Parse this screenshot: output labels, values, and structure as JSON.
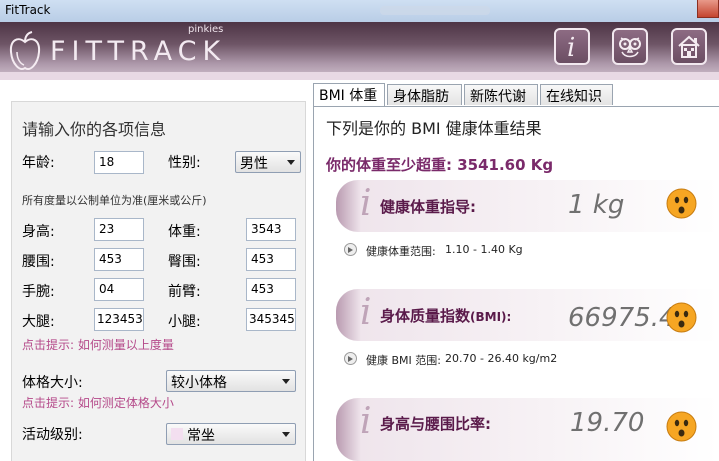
{
  "window": {
    "title": "FitTrack"
  },
  "header": {
    "logo_text": "FITTRACK",
    "logo_sub": "pinkies",
    "buttons": [
      {
        "name": "info-icon"
      },
      {
        "name": "owl-icon"
      },
      {
        "name": "home-icon"
      }
    ]
  },
  "form": {
    "title": "请输入你的各项信息",
    "age_label": "年龄:",
    "age_value": "18",
    "gender_label": "性别:",
    "gender_value": "男性",
    "units_note": "所有度量以公制单位为准(厘米或公斤)",
    "height_label": "身高:",
    "height_value": "23",
    "weight_label": "体重:",
    "weight_value": "3543",
    "waist_label": "腰围:",
    "waist_value": "453",
    "hip_label": "臀围:",
    "hip_value": "453",
    "wrist_label": "手腕:",
    "wrist_value": "04",
    "forearm_label": "前臂:",
    "forearm_value": "453",
    "thigh_label": "大腿:",
    "thigh_value": "123453",
    "calf_label": "小腿:",
    "calf_value": "345345",
    "measure_hint": "点击提示: 如何测量以上度量",
    "frame_label": "体格大小:",
    "frame_value": "较小体格",
    "frame_hint": "点击提示: 如何测定体格大小",
    "activity_label": "活动级别:",
    "activity_value": "常坐"
  },
  "tabs": [
    "BMI 体重",
    "身体脂肪",
    "新陈代谢",
    "在线知识"
  ],
  "results": {
    "heading": "下列是你的 BMI 健康体重结果",
    "overweight_text": "你的体重至少超重: 3541.60 Kg",
    "cards": [
      {
        "title": "健康体重指导:",
        "value": "1 kg",
        "range_label": "健康体重范围:",
        "range_value": "1.10 - 1.40 Kg"
      },
      {
        "title": "身体质量指数",
        "title_suffix": "(BMI):",
        "value": "66975.4",
        "range_label": "健康 BMI 范围:",
        "range_value": "20.70 - 26.40 kg/m2"
      },
      {
        "title": "身高与腰围比率:",
        "value": "19.70"
      }
    ]
  },
  "colors": {
    "accent": "#7a2a6a",
    "hint": "#b54a8a",
    "face": "#f6a623"
  }
}
